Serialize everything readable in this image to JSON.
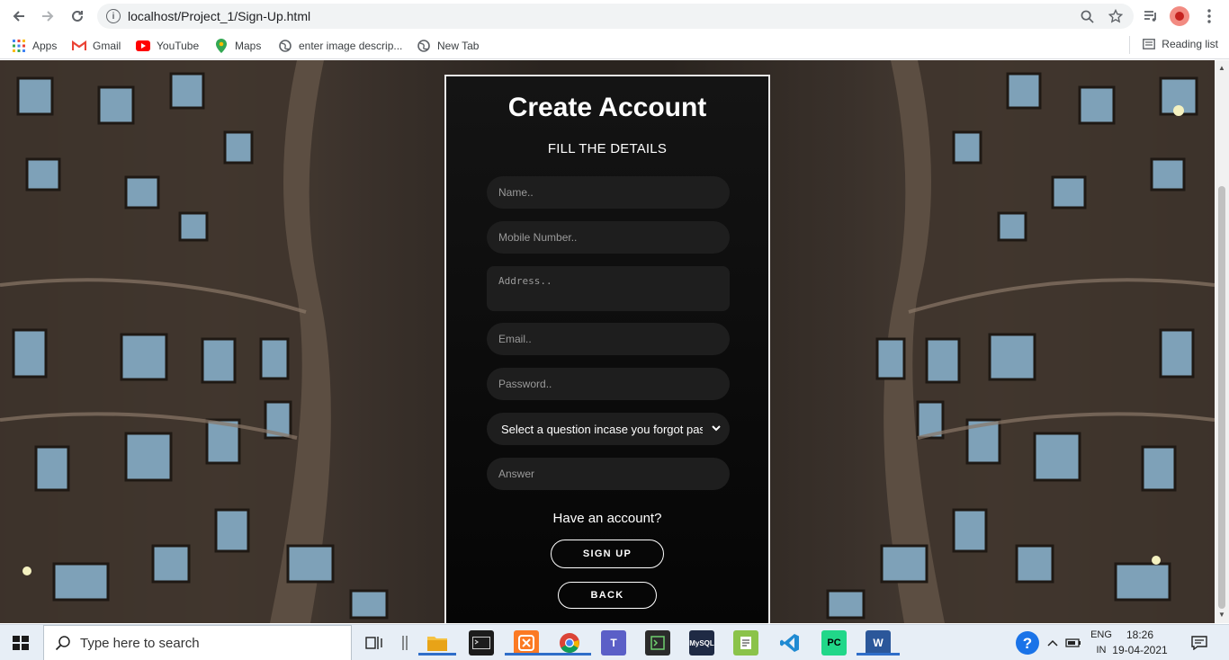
{
  "browser": {
    "url": "localhost/Project_1/Sign-Up.html",
    "bookmarks": [
      {
        "label": "Apps",
        "icon": "apps-grid-icon"
      },
      {
        "label": "Gmail",
        "icon": "gmail-icon"
      },
      {
        "label": "YouTube",
        "icon": "youtube-icon"
      },
      {
        "label": "Maps",
        "icon": "maps-icon"
      },
      {
        "label": "enter image descrip...",
        "icon": "globe-icon"
      },
      {
        "label": "New Tab",
        "icon": "globe-icon"
      }
    ],
    "reading_list": "Reading list"
  },
  "form": {
    "title": "Create Account",
    "subtitle": "FILL THE DETAILS",
    "name_placeholder": "Name..",
    "mobile_placeholder": "Mobile Number..",
    "address_placeholder": "Address..",
    "email_placeholder": "Email..",
    "password_placeholder": "Password..",
    "question_selected": "Select a question incase you forgot password",
    "answer_placeholder": "Answer",
    "have_account": "Have an account?",
    "signup_label": "SIGN UP",
    "back_label": "BACK"
  },
  "taskbar": {
    "search_placeholder": "Type here to search",
    "language": "ENG",
    "region": "IN",
    "time": "18:26",
    "date": "19-04-2021",
    "apps": [
      "task-view-icon",
      "file-explorer-icon",
      "terminal-icon",
      "xampp-icon",
      "chrome-icon",
      "teams-icon",
      "app-icon",
      "mysql-icon",
      "notepad-icon",
      "vscode-icon",
      "pycharm-icon",
      "word-icon"
    ]
  },
  "colors": {
    "card_bg": "#0d0d0d",
    "field_bg": "#1e1e1e",
    "accent": "#ffffff"
  }
}
